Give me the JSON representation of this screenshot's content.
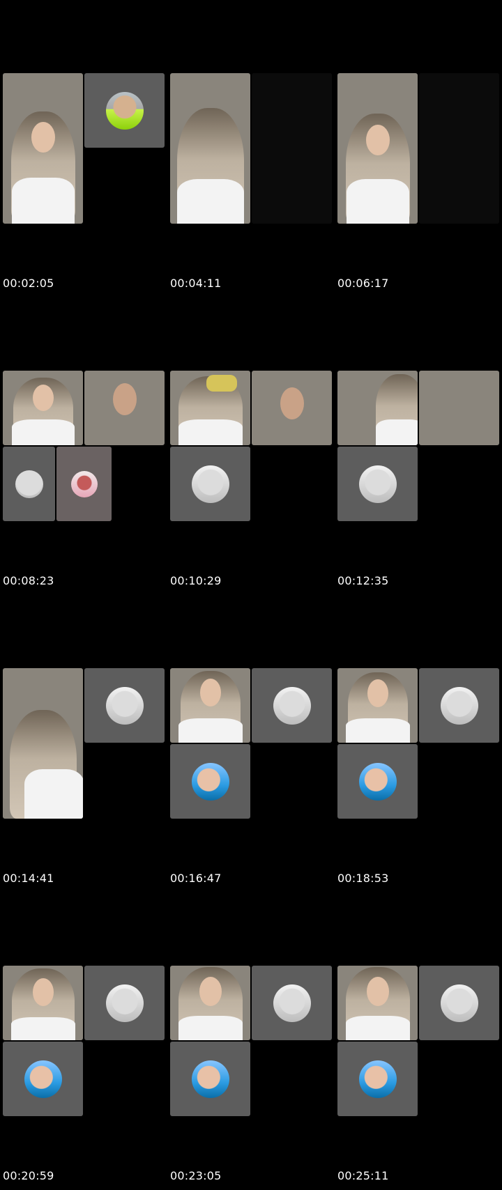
{
  "timestamps": [
    "00:02:05",
    "00:04:11",
    "00:06:17",
    "00:08:23",
    "00:10:29",
    "00:12:35",
    "00:14:41",
    "00:16:47",
    "00:18:53",
    "00:20:59",
    "00:23:05",
    "00:25:11"
  ],
  "colors": {
    "background": "#000000",
    "tile_gray": "#5d5d5d",
    "timestamp_text": "#ffffff"
  }
}
